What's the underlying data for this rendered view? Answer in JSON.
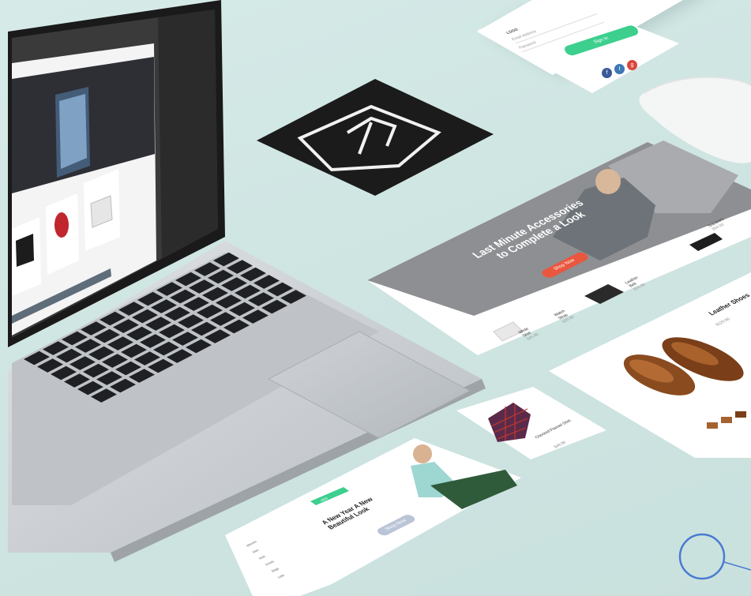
{
  "login_card": {
    "brand": "LOGO",
    "field_email": "Email Address",
    "field_password": "Password",
    "button_label": "Sign In",
    "social": [
      "f",
      "t",
      "g"
    ],
    "social_colors": [
      "#3b5998",
      "#3d78b5",
      "#d9473b"
    ]
  },
  "hero_card": {
    "headline_line1": "Last Minute Accessories",
    "headline_line2": "to Complete a Look",
    "cta_label": "Shop Now",
    "products": [
      {
        "name": "Sneakers",
        "price": "$59.00"
      },
      {
        "name": "Leather Belt",
        "price": "$24.00"
      },
      {
        "name": "Watch Strap",
        "price": "$39.00"
      },
      {
        "name": "White Shirt",
        "price": "$45.00"
      }
    ]
  },
  "shoes_card": {
    "title": "Leather Shoes",
    "price": "$129.00"
  },
  "shirt_card": {
    "title": "Checked Flannel Shirt",
    "price": "$49.00"
  },
  "fashion_card": {
    "headline": "A New Year A New Beautiful Look",
    "cta_label": "Shop Now",
    "tag": "NEW",
    "menu": [
      "Women",
      "Men",
      "Kids",
      "Shoes",
      "Bags",
      "Sale"
    ]
  },
  "colors": {
    "background": "#cfe6e3",
    "accent_green": "#3ccf8e",
    "accent_red": "#e9573f",
    "logo_bg": "#1b1b1b"
  }
}
